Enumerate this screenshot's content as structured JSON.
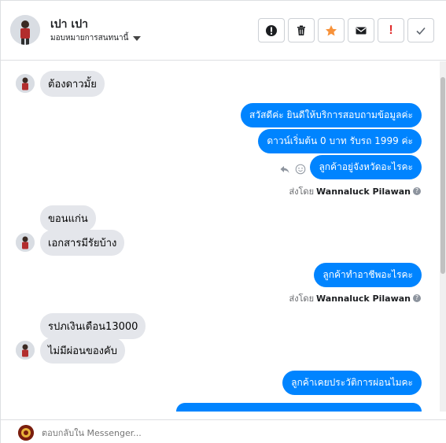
{
  "header": {
    "name": "เปา เปา",
    "assign_label": "มอบหมายการสนทนานี้",
    "toolbar": [
      {
        "id": "info",
        "icon": "info-icon"
      },
      {
        "id": "delete",
        "icon": "trash-icon"
      },
      {
        "id": "star",
        "icon": "star-icon"
      },
      {
        "id": "mail",
        "icon": "envelope-icon"
      },
      {
        "id": "spam",
        "icon": "exclamation-icon"
      },
      {
        "id": "done",
        "icon": "check-icon"
      }
    ]
  },
  "colors": {
    "outgoing": "#0084ff",
    "incoming": "#e4e6eb",
    "star": "#f7923a",
    "spam": "#e02b2b"
  },
  "messages": {
    "m1": "ต้องดาวมั้ย",
    "m2": "สวัสดีค่ะ  ยินดีให้บริการสอบถามข้อมูลค่ะ",
    "m3": "ดาวน์เริ่มต้น 0 บาท รับรถ 1999 ค่ะ",
    "m4": "ลูกค้าอยู่จังหวัดอะไรคะ",
    "m5": "ขอนแก่น",
    "m6": "เอกสารมีรัยบ้าง",
    "m7": "ลูกค้าทำอาชีพอะไรคะ",
    "m8": "รปภเงินเดือน13000",
    "m9": "ไม่มีผ่อนของคับ",
    "m10": "ลูกค้าเคยประวัติการผ่อนไมคะ"
  },
  "sender_prefix": "ส่งโดย",
  "sender_name": "Wannaluck Pilawan",
  "composer": {
    "placeholder": "ตอบกลับใน Messenger..."
  }
}
